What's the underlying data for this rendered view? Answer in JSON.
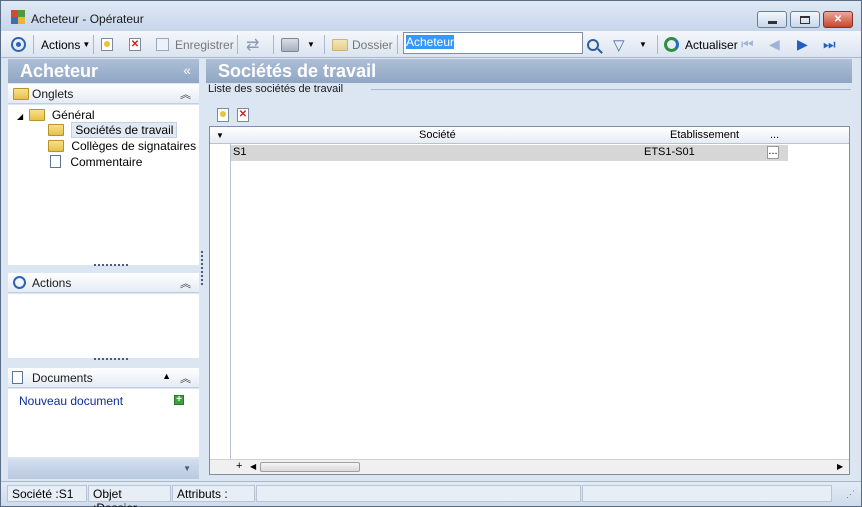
{
  "window": {
    "title": "Acheteur -  Opérateur",
    "minimize_icon": "minimize-icon",
    "maximize_icon": "maximize-icon",
    "close_icon": "close-icon"
  },
  "toolbar": {
    "actions_label": "Actions",
    "save_label": "Enregistrer",
    "folder_label": "Dossier",
    "search_value": "Acheteur",
    "refresh_label": "Actualiser"
  },
  "left": {
    "title": "Acheteur",
    "tabs_section": {
      "label": "Onglets",
      "tree": {
        "root": "Général",
        "children": [
          "Sociétés de travail",
          "Collèges de signataires",
          "Commentaire"
        ]
      }
    },
    "actions_section": {
      "label": "Actions"
    },
    "documents_section": {
      "label": "Documents",
      "new_document": "Nouveau document"
    }
  },
  "main": {
    "title": "Sociétés de travail",
    "group_label": "Liste des sociétés de travail",
    "grid": {
      "columns": [
        "Société",
        "Etablissement",
        "..."
      ],
      "rows": [
        {
          "societe": "S1",
          "etablissement": "ETS1-S01",
          "more": "..."
        }
      ],
      "footer_add": "+"
    }
  },
  "statusbar": {
    "societe": "Société :S1",
    "objet": "Objet :Dossier",
    "attributs": "Attributs :"
  },
  "colors": {
    "header_gradient_top": "#aebfd6",
    "header_gradient_bottom": "#8fa6c4",
    "panel_bg": "#dce6f2",
    "link": "#0b2e9a",
    "selected_row": "#d6d6d6"
  }
}
